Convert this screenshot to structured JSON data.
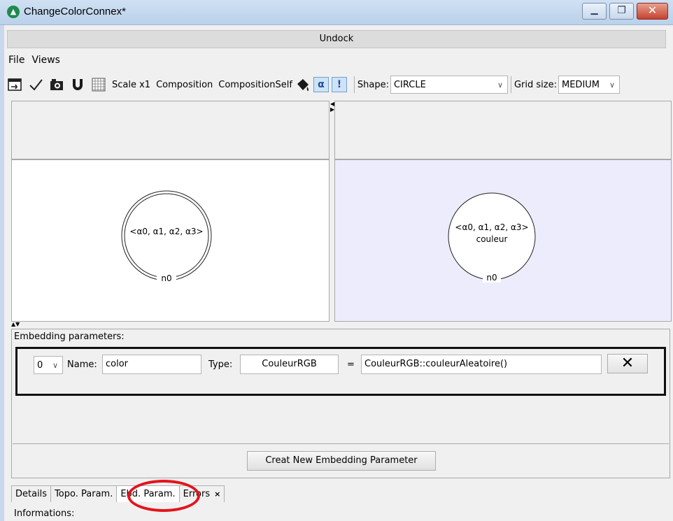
{
  "window": {
    "title": "ChangeColorConnex*",
    "app_icon": "jerboa-icon"
  },
  "undock_label": "Undock",
  "menu": [
    "File",
    "Views"
  ],
  "toolbar": {
    "scale_label": "Scale x1",
    "composition_label": "Composition",
    "composition_self_label": "CompositionSelf",
    "alpha_toggle": "α",
    "bang_toggle": "!",
    "shape_label": "Shape:",
    "shape_value": "CIRCLE",
    "grid_label": "Grid size:",
    "grid_value": "MEDIUM"
  },
  "left_node": {
    "label": "<α0, α1, α2, α3>",
    "name": "n0"
  },
  "right_node": {
    "label": "<α0, α1, α2, α3>",
    "sub": "couleur",
    "name": "n0"
  },
  "embedding": {
    "section_title": "Embedding parameters:",
    "index_value": "0",
    "name_label": "Name:",
    "name_value": "color",
    "type_label": "Type:",
    "type_value": "CouleurRGB",
    "equals": "=",
    "expression": "CouleurRGB::couleurAleatoire()",
    "delete_symbol": "✕",
    "create_button": "Creat New Embedding Parameter"
  },
  "tabs": [
    {
      "label": "Details"
    },
    {
      "label": "Topo. Param."
    },
    {
      "label": "Ebd. Param."
    },
    {
      "label": "Errors"
    }
  ],
  "errors_close": "×",
  "info_label": "Informations:",
  "colors": {
    "right_canvas": "#ececfc",
    "highlight_circle": "#e3141c"
  }
}
